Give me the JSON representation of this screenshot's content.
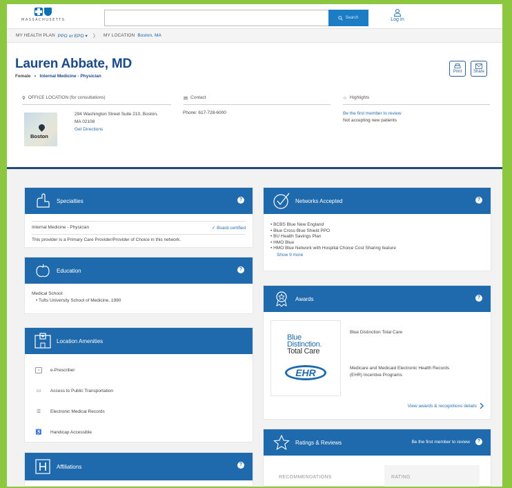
{
  "brand": {
    "name": "MASSACHUSETTS"
  },
  "search": {
    "value": "",
    "button_label": "Search"
  },
  "account": {
    "login_label": "Log In"
  },
  "breadcrumbs": {
    "plan_label": "MY HEALTH PLAN",
    "plan_value": "PPO or EPO ▾",
    "separator": "〉",
    "location_label": "MY LOCATION",
    "location_value": "Boston, MA"
  },
  "provider": {
    "name": "Lauren Abbate, MD",
    "gender": "Female",
    "dot": "•",
    "specialty": "Internal Medicine - Physician"
  },
  "actions": {
    "print_label": "Print",
    "share_label": "Share"
  },
  "sections": {
    "office_label": "OFFICE LOCATION (for consultations)",
    "contact_label": "Contact",
    "highlights_label": "Highlights"
  },
  "office": {
    "map_city": "Boston",
    "address_line1": "294 Washington Street Suite 210, Boston,",
    "address_line2": "MA 02108",
    "directions_label": "Get Directions"
  },
  "contact": {
    "phone": "Phone: 617-728-6000"
  },
  "highlights": {
    "review_link": "Be the first member to review",
    "status": "Not accepting new patients"
  },
  "specialties": {
    "title": "Specialties",
    "item": "Internal Medicine - Physician",
    "certified": "✓ Board certified",
    "pcp_note": "This provider is a Primary Care Provider/Provider of Choice in this network."
  },
  "education": {
    "title": "Education",
    "label": "Medical School:",
    "school": "•  Tufts University School of Medicine, 1990"
  },
  "amenities": {
    "title": "Location Amenities",
    "items": [
      {
        "label": "e-Prescriber",
        "icon": "e-prescriber-icon"
      },
      {
        "label": "Access to Public Transportation",
        "icon": "bus-icon"
      },
      {
        "label": "Electronic Medical Records",
        "icon": "records-icon"
      },
      {
        "label": "Handicap Accessible",
        "icon": "wheelchair-icon"
      }
    ]
  },
  "affiliations": {
    "title": "Affiliations"
  },
  "networks": {
    "title": "Networks Accepted",
    "items": [
      "BCBS Blue New England",
      "Blue Cross Blue Shield PPO",
      "BU Health Savings Plan",
      "HMO Blue",
      "HMO Blue Network with Hospital Choice Cost Sharing feature"
    ],
    "show_more": "Show 9 more"
  },
  "awards": {
    "title": "Awards",
    "bd_line1": "Blue",
    "bd_line2": "Distinction.",
    "bd_line3": "Total Care",
    "ehr_logo": "EHR",
    "award1": "Blue Distinction Total Care",
    "award2_line1": "Medicare and Medicaid Electronic Health Records",
    "award2_line2": "(EHR) Incentive Programs",
    "details_link": "View awards & recognitions details"
  },
  "ratings": {
    "title": "Ratings & Reviews",
    "review_link": "Be the first member to review",
    "recommendations_label": "RECOMMENDATIONS",
    "rating_label": "RATING"
  },
  "colors": {
    "accent": "#1f6aad",
    "navy": "#1a4a8a",
    "frame": "#8dc63f"
  }
}
